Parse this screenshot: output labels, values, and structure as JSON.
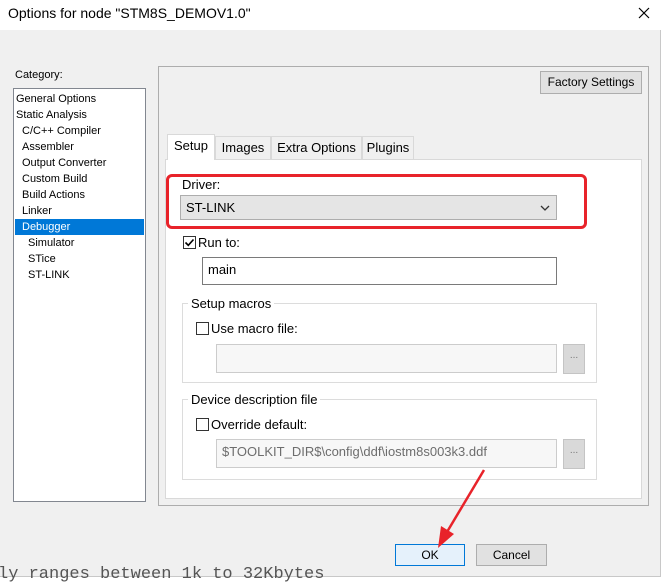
{
  "window": {
    "title": "Options for node \"STM8S_DEMOV1.0\""
  },
  "category": {
    "label": "Category:",
    "items": [
      {
        "label": "General Options"
      },
      {
        "label": "Static Analysis"
      },
      {
        "label": "C/C++ Compiler"
      },
      {
        "label": "Assembler"
      },
      {
        "label": "Output Converter"
      },
      {
        "label": "Custom Build"
      },
      {
        "label": "Build Actions"
      },
      {
        "label": "Linker"
      },
      {
        "label": "Debugger"
      },
      {
        "label": "Simulator"
      },
      {
        "label": "STice"
      },
      {
        "label": "ST-LINK"
      }
    ],
    "selected": "Debugger"
  },
  "factory_settings_label": "Factory Settings",
  "tabs": [
    {
      "label": "Setup",
      "active": true
    },
    {
      "label": "Images"
    },
    {
      "label": "Extra Options"
    },
    {
      "label": "Plugins"
    }
  ],
  "setup": {
    "driver_label": "Driver:",
    "driver_value": "ST-LINK",
    "run_to_label": "Run to:",
    "run_to_checked": true,
    "run_to_value": "main",
    "setup_macros_title": "Setup macros",
    "use_macro_label": "Use macro file:",
    "use_macro_checked": false,
    "macro_file_value": "",
    "browse_label": "...",
    "device_desc_title": "Device description file",
    "override_label": "Override default:",
    "override_checked": false,
    "ddf_value": "$TOOLKIT_DIR$\\config\\ddf\\iostm8s003k3.ddf"
  },
  "buttons": {
    "ok": "OK",
    "cancel": "Cancel"
  },
  "background_text": "ly ranges between 1k to 32Kbytes",
  "colors": {
    "selection": "#0078d7",
    "highlight": "#e8232a"
  }
}
